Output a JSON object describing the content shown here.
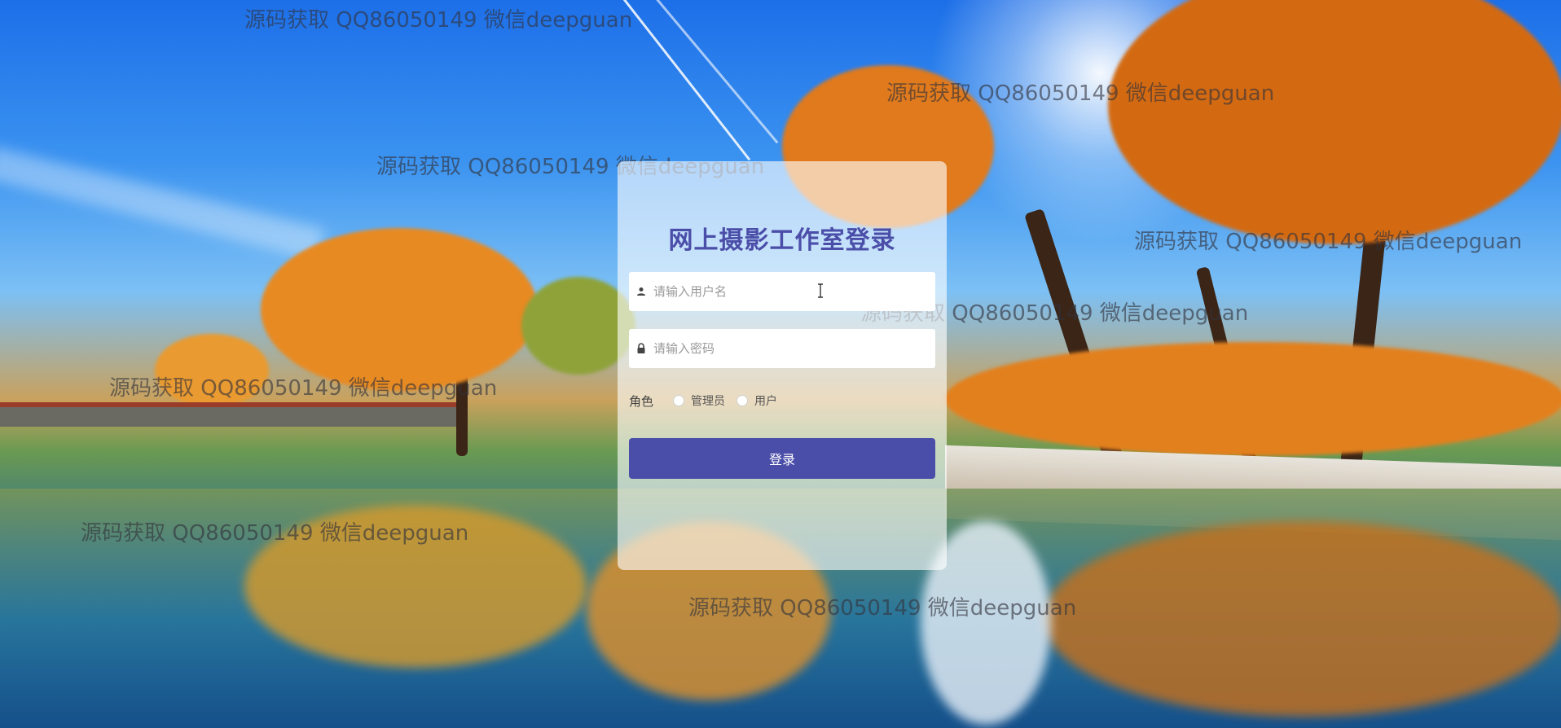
{
  "login": {
    "title": "网上摄影工作室登录",
    "username_placeholder": "请输入用户名",
    "password_placeholder": "请输入密码",
    "role_label": "角色",
    "role_options": [
      "管理员",
      "用户"
    ],
    "submit_label": "登录"
  },
  "watermark": {
    "text": "源码获取 QQ86050149 微信deepguan"
  },
  "colors": {
    "accent": "#4b4ea8",
    "card_background": "rgba(255,255,255,0.62)"
  },
  "icons": {
    "username": "user-icon",
    "password": "lock-icon"
  }
}
